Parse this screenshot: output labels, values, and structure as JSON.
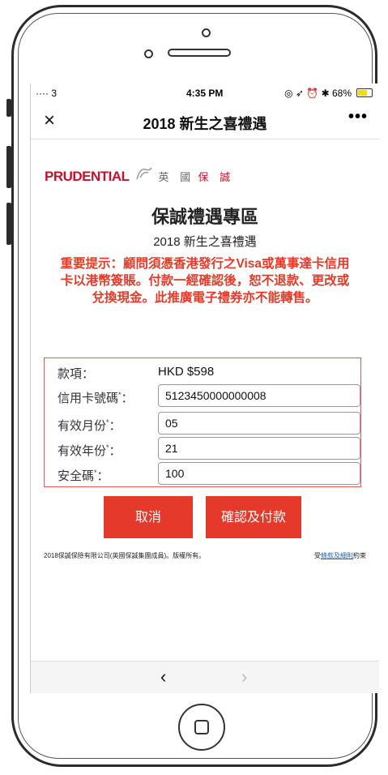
{
  "status_bar": {
    "left": "···· 3 ",
    "time": "4:35 PM",
    "right": "◎ ➶ ⏰ ✱ 68%",
    "battery_level": 0.68
  },
  "nav": {
    "close_glyph": "×",
    "title": "2018 新生之喜禮遇",
    "more_glyph": "•••"
  },
  "logo": {
    "word": "PRUDENTIAL",
    "cn_black": "英 國",
    "cn_red": "保 誠"
  },
  "page": {
    "title": "保誠禮遇專區",
    "subtitle": "2018 新生之喜禮遇",
    "notice": "重要提示：顧問須憑香港發行之Visa或萬事達卡信用卡以港幣簽賬。付款一經確認後，恕不退款、更改或兌換現金。此推廣電子禮券亦不能轉售。"
  },
  "form": {
    "amount_label": "款項：",
    "amount_value": "HKD $598",
    "card_label": "信用卡號碼",
    "card_value": "5123450000000008",
    "month_label": "有效月份",
    "month_value": "05",
    "year_label": "有效年份",
    "year_value": "21",
    "cvv_label": "安全碼",
    "cvv_value": "100",
    "required_mark": "*",
    "colon": "："
  },
  "buttons": {
    "cancel": "取消",
    "confirm": "確認及付款"
  },
  "footer": {
    "copyright": "2018保誠保險有限公司(英國保誠集團成員)。版權所有。",
    "terms_prefix": "受",
    "terms_link": "條款及細則",
    "terms_suffix": "約束"
  },
  "bottom_nav": {
    "back_glyph": "‹",
    "forward_glyph": "›"
  },
  "colors": {
    "accent": "#e5392c",
    "brand": "#c8102e",
    "link": "#1a5fb4"
  }
}
